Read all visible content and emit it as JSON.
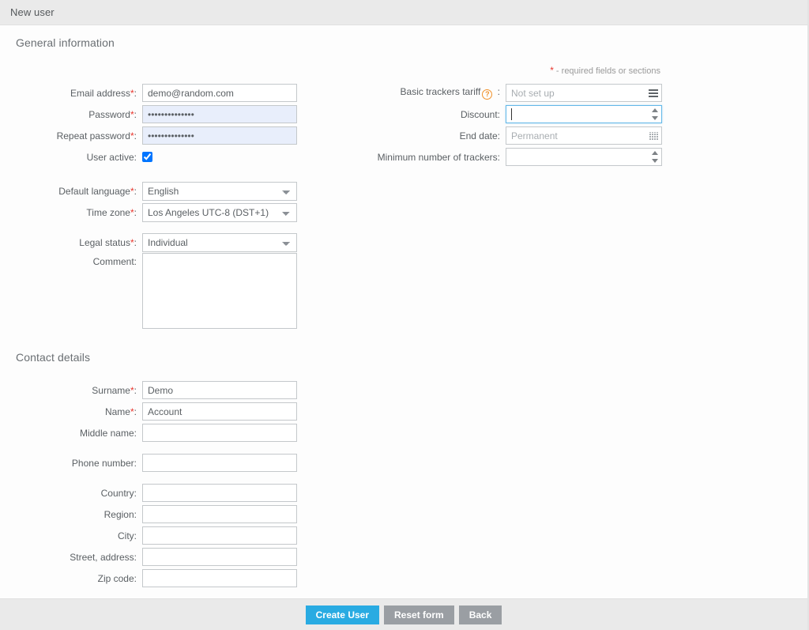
{
  "window": {
    "title": "New user"
  },
  "general": {
    "heading": "General information",
    "required_note_star": "*",
    "required_note_text": " - required fields or sections",
    "fields": {
      "email": {
        "label": "Email address",
        "required": true,
        "value": "demo@random.com"
      },
      "password": {
        "label": "Password",
        "required": true,
        "value": "••••••••••••••"
      },
      "repeat_password": {
        "label": "Repeat password",
        "required": true,
        "value": "••••••••••••••"
      },
      "user_active": {
        "label": "User active",
        "checked": true
      },
      "default_language": {
        "label": "Default language",
        "required": true,
        "value": "English",
        "options": [
          "English"
        ]
      },
      "time_zone": {
        "label": "Time zone",
        "required": true,
        "value": "Los Angeles UTC-8 (DST+1)",
        "options": [
          "Los Angeles UTC-8 (DST+1)"
        ]
      },
      "legal_status": {
        "label": "Legal status",
        "required": true,
        "value": "Individual",
        "options": [
          "Individual"
        ]
      },
      "comment": {
        "label": "Comment",
        "value": ""
      }
    },
    "billing": {
      "basic_tariff": {
        "label": "Basic trackers tariff",
        "help": "?",
        "suffix": " :",
        "placeholder": "Not set up",
        "value": "",
        "icon": "list-icon"
      },
      "discount": {
        "label": "Discount",
        "value": "",
        "focused": true,
        "icon": "spinner-icon"
      },
      "end_date": {
        "label": "End date",
        "placeholder": "Permanent",
        "value": "",
        "icon": "calendar-icon"
      },
      "min_trackers": {
        "label": "Minimum number of trackers",
        "value": "",
        "icon": "spinner-icon"
      }
    }
  },
  "contact": {
    "heading": "Contact details",
    "fields": {
      "surname": {
        "label": "Surname",
        "required": true,
        "value": "Demo"
      },
      "name": {
        "label": "Name",
        "required": true,
        "value": "Account"
      },
      "middle_name": {
        "label": "Middle name",
        "value": ""
      },
      "phone_number": {
        "label": "Phone number",
        "value": ""
      },
      "country": {
        "label": "Country",
        "value": ""
      },
      "region": {
        "label": "Region",
        "value": ""
      },
      "city": {
        "label": "City",
        "value": ""
      },
      "street": {
        "label": "Street, address",
        "value": ""
      },
      "zip": {
        "label": "Zip code",
        "value": ""
      }
    }
  },
  "footer": {
    "create": "Create User",
    "reset": "Reset form",
    "back": "Back"
  },
  "colors": {
    "accent": "#29abe2",
    "muted_button": "#9a9ea3",
    "required_star": "#e8352c",
    "help_icon": "#f0922b",
    "chrome": "#eaeaea",
    "autofill": "#e8eefb",
    "focus_border": "#63b8e8"
  }
}
